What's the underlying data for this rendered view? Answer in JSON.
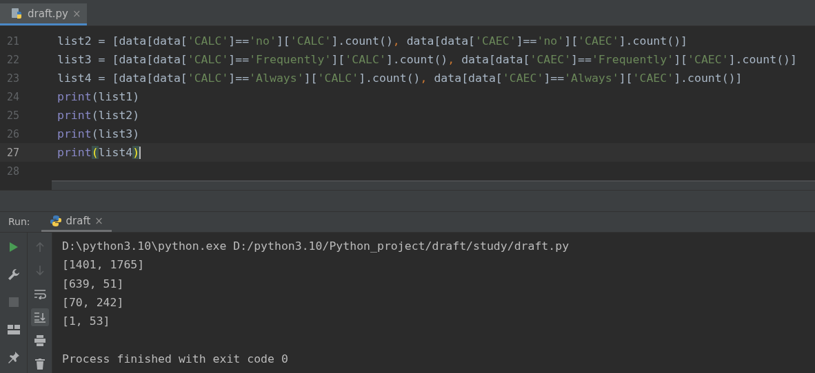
{
  "editor": {
    "tabs": [
      {
        "label": "draft.py",
        "selected": true,
        "close": "×"
      }
    ],
    "lines": [
      {
        "number": "21",
        "current": false,
        "tokens": [
          {
            "kind": "text",
            "text": "list2 = [data[data["
          },
          {
            "kind": "string",
            "text": "'CALC'"
          },
          {
            "kind": "text",
            "text": "]=="
          },
          {
            "kind": "string",
            "text": "'no'"
          },
          {
            "kind": "text",
            "text": "]["
          },
          {
            "kind": "string",
            "text": "'CALC'"
          },
          {
            "kind": "text",
            "text": "].count()"
          },
          {
            "kind": "comma",
            "text": ","
          },
          {
            "kind": "text",
            "text": " data[data["
          },
          {
            "kind": "string",
            "text": "'CAEC'"
          },
          {
            "kind": "text",
            "text": "]=="
          },
          {
            "kind": "string",
            "text": "'no'"
          },
          {
            "kind": "text",
            "text": "]["
          },
          {
            "kind": "string",
            "text": "'CAEC'"
          },
          {
            "kind": "text",
            "text": "].count()]"
          }
        ]
      },
      {
        "number": "22",
        "current": false,
        "tokens": [
          {
            "kind": "text",
            "text": "list3 = [data[data["
          },
          {
            "kind": "string",
            "text": "'CALC'"
          },
          {
            "kind": "text",
            "text": "]=="
          },
          {
            "kind": "string",
            "text": "'Frequently'"
          },
          {
            "kind": "text",
            "text": "]["
          },
          {
            "kind": "string",
            "text": "'CALC'"
          },
          {
            "kind": "text",
            "text": "].count()"
          },
          {
            "kind": "comma",
            "text": ","
          },
          {
            "kind": "text",
            "text": " data[data["
          },
          {
            "kind": "string",
            "text": "'CAEC'"
          },
          {
            "kind": "text",
            "text": "]=="
          },
          {
            "kind": "string",
            "text": "'Frequently'"
          },
          {
            "kind": "text",
            "text": "]["
          },
          {
            "kind": "string",
            "text": "'CAEC'"
          },
          {
            "kind": "text",
            "text": "].count()]"
          }
        ]
      },
      {
        "number": "23",
        "current": false,
        "tokens": [
          {
            "kind": "text",
            "text": "list4 = [data[data["
          },
          {
            "kind": "string",
            "text": "'CALC'"
          },
          {
            "kind": "text",
            "text": "]=="
          },
          {
            "kind": "string",
            "text": "'Always'"
          },
          {
            "kind": "text",
            "text": "]["
          },
          {
            "kind": "string",
            "text": "'CALC'"
          },
          {
            "kind": "text",
            "text": "].count()"
          },
          {
            "kind": "comma",
            "text": ","
          },
          {
            "kind": "text",
            "text": " data[data["
          },
          {
            "kind": "string",
            "text": "'CAEC'"
          },
          {
            "kind": "text",
            "text": "]=="
          },
          {
            "kind": "string",
            "text": "'Always'"
          },
          {
            "kind": "text",
            "text": "]["
          },
          {
            "kind": "string",
            "text": "'CAEC'"
          },
          {
            "kind": "text",
            "text": "].count()]"
          }
        ]
      },
      {
        "number": "24",
        "current": false,
        "tokens": [
          {
            "kind": "builtin",
            "text": "print"
          },
          {
            "kind": "text",
            "text": "(list1)"
          }
        ]
      },
      {
        "number": "25",
        "current": false,
        "tokens": [
          {
            "kind": "builtin",
            "text": "print"
          },
          {
            "kind": "text",
            "text": "(list2)"
          }
        ]
      },
      {
        "number": "26",
        "current": false,
        "tokens": [
          {
            "kind": "builtin",
            "text": "print"
          },
          {
            "kind": "text",
            "text": "(list3)"
          }
        ]
      },
      {
        "number": "27",
        "current": true,
        "tokens": [
          {
            "kind": "builtin",
            "text": "print"
          },
          {
            "kind": "match",
            "text": "("
          },
          {
            "kind": "text",
            "text": "list4"
          },
          {
            "kind": "match",
            "text": ")"
          }
        ]
      },
      {
        "number": "28",
        "current": false
      }
    ]
  },
  "run_panel": {
    "label": "Run:",
    "tabs": [
      {
        "label": "draft",
        "selected": true,
        "close": "×"
      }
    ],
    "tools": [
      {
        "kind": "up",
        "disabled": true
      },
      {
        "kind": "down",
        "disabled": true
      },
      {
        "kind": "wrap",
        "disabled": false,
        "selected": false
      },
      {
        "kind": "scroll-end",
        "disabled": false,
        "selected": true
      },
      {
        "kind": "print",
        "disabled": false,
        "selected": false
      },
      {
        "kind": "trash",
        "disabled": false,
        "selected": false
      }
    ],
    "console": [
      "D:\\python3.10\\python.exe D:/python3.10/Python_project/draft/study/draft.py",
      "[1401, 1765]",
      "[639, 51]",
      "[70, 242]",
      "[1, 53]"
    ],
    "exit_message": "Process finished with exit code 0"
  }
}
